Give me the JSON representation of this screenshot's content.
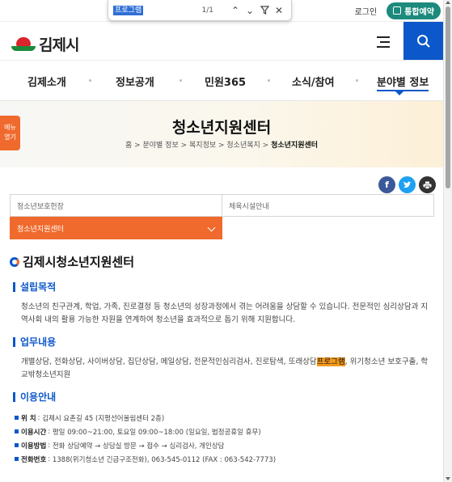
{
  "find_bar": {
    "query": "프로그램",
    "count": "1/1"
  },
  "top": {
    "login": "로그인",
    "join": "통합예약"
  },
  "header": {
    "logo_text": "김제시"
  },
  "nav": {
    "items": [
      "김제소개",
      "정보공개",
      "민원365",
      "소식/참여",
      "분야별 정보"
    ],
    "active": "분야별 정보"
  },
  "hero": {
    "title": "청소년지원센터",
    "breadcrumb": [
      "홈",
      "분야별 정보",
      "복지정보",
      "청소년복지",
      "청소년지원센터"
    ]
  },
  "menu_tab": {
    "line1": "메뉴",
    "line2": "열기"
  },
  "tabs": [
    "청소년보호헌장",
    "체육시설안내",
    "청소년지원센터"
  ],
  "content": {
    "title": "김제시청소년지원센터",
    "sections": [
      {
        "heading": "설립목적",
        "text": "청소년의 친구관계, 학업, 가족, 진로결정 등 청소년의 성장과정에서 겪는 어려움을 상담할 수 있습니다. 전문적인 심리상담과 지역사회 내의 활용 가능한 자원을 연계하여 청소년을 효과적으로 돕기 위해 지원합니다."
      },
      {
        "heading": "업무내용",
        "text_before": "개별상담, 전화상담, 사이버상담, 집단상담, 메일상담, 전문적인심리검사, 진로탐색, 또래상담",
        "highlight": "프로그램",
        "text_after": ", 위기청소년 보호구출, 학교밖청소년지원"
      },
      {
        "heading": "이용안내"
      }
    ],
    "info": [
      {
        "label": "위 치",
        "value": "김제시 요촌길 45 (지평선어울림센터 2층)"
      },
      {
        "label": "이용시간",
        "value": "평일 09:00~21:00, 토요일 09:00~18:00 (일요일, 법정공휴일 휴무)"
      },
      {
        "label": "이용방법",
        "value": "전화 상담예약 → 상담실 방문 → 접수 → 심리검사, 개인상담"
      },
      {
        "label": "전화번호",
        "value": "1388(위기청소년 긴급구조전화), 063-545-0112 (FAX : 063-542-7773)"
      }
    ]
  },
  "colors": {
    "primary": "#0c57c9",
    "accent": "#ef6a2c",
    "join": "#1c8a7c",
    "highlight": "#f39a1c"
  }
}
